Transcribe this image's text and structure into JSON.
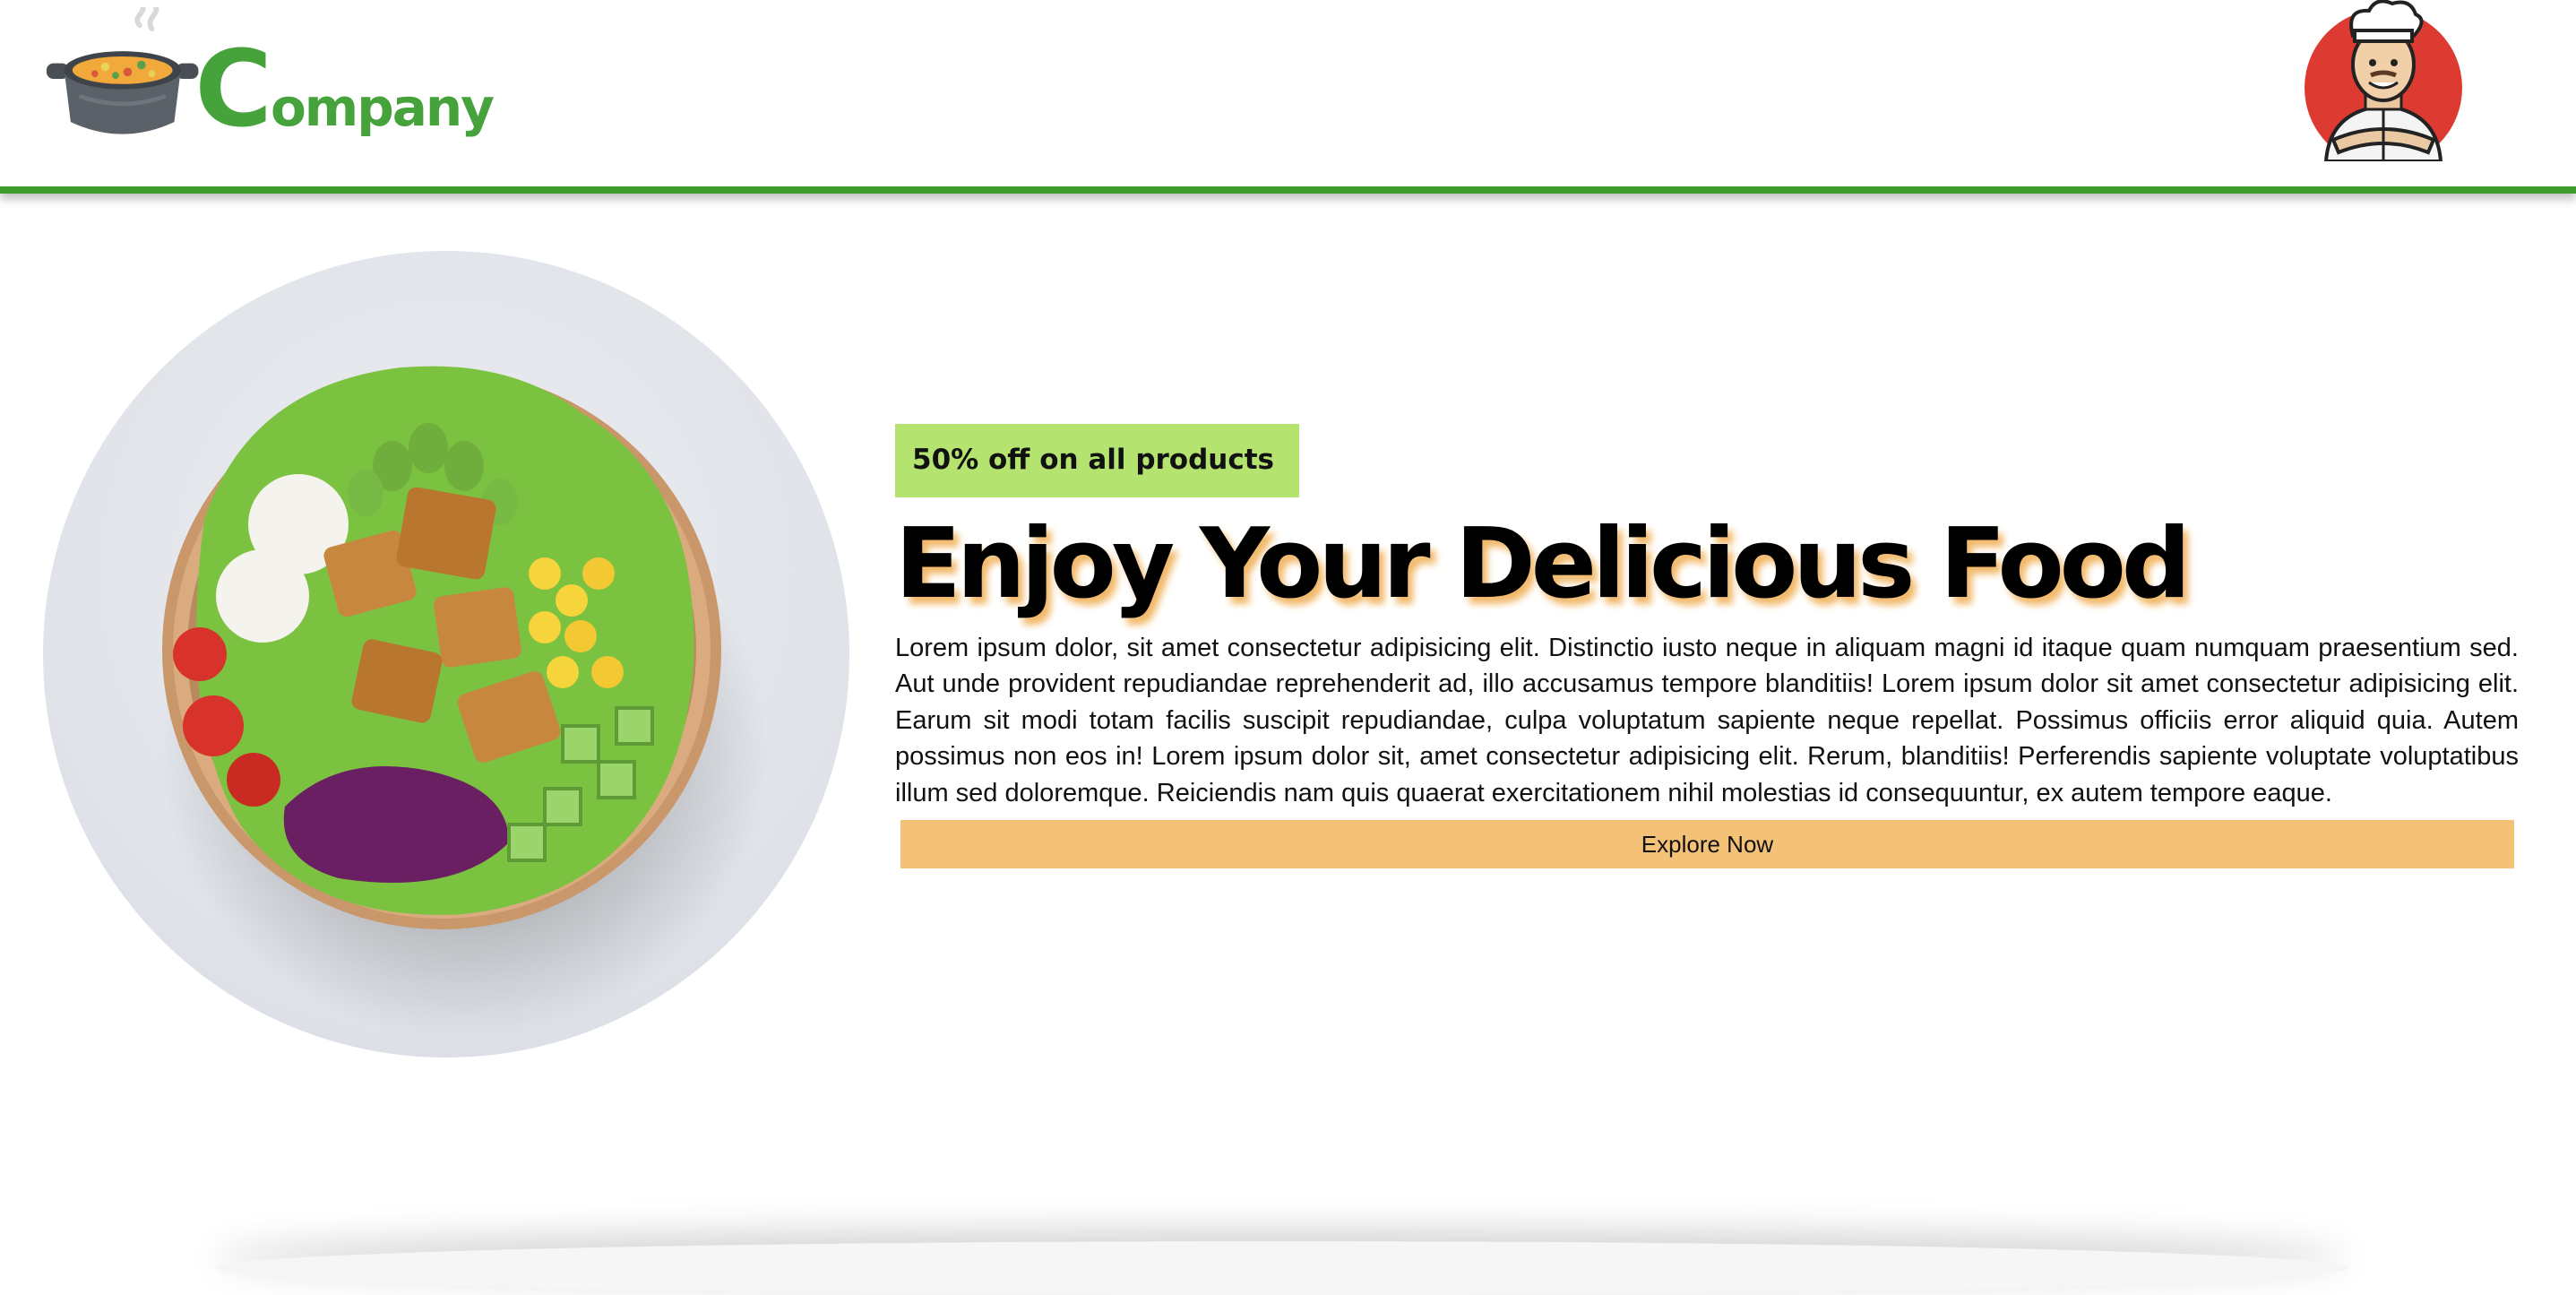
{
  "header": {
    "brand": {
      "first_letter": "C",
      "rest": "ompany"
    },
    "logo_icon": "cooking-pot-icon",
    "avatar": "chef-avatar"
  },
  "hero": {
    "badge": "50% off on all products",
    "title": "Enjoy Your Delicious Food",
    "description": "Lorem ipsum dolor, sit amet consectetur adipisicing elit. Distinctio iusto neque in aliquam magni id itaque quam numquam praesentium sed. Aut unde provident repudiandae reprehenderit ad, illo accusamus tempore blanditiis! Lorem ipsum dolor sit amet consectetur adipisicing elit. Earum sit modi totam facilis suscipit repudiandae, culpa voluptatum sapiente neque repellat. Possimus officiis error aliquid quia. Autem possimus non eos in! Lorem ipsum dolor sit, amet consectetur adipisicing elit. Rerum, blanditiis! Perferendis sapiente voluptate voluptatibus illum sed doloremque. Reiciendis nam quis quaerat exercitationem nihil molestias id consequuntur, ex autem tempore eaque.",
    "button": "Explore Now",
    "image": "salad-bowl-image"
  },
  "colors": {
    "brand_green": "#46a23a",
    "header_border": "#3e9a2a",
    "badge_bg": "#b4e46f",
    "button_bg": "#f4c276",
    "title_shadow": "#f2b96a",
    "avatar_bg": "#dd3b32"
  }
}
